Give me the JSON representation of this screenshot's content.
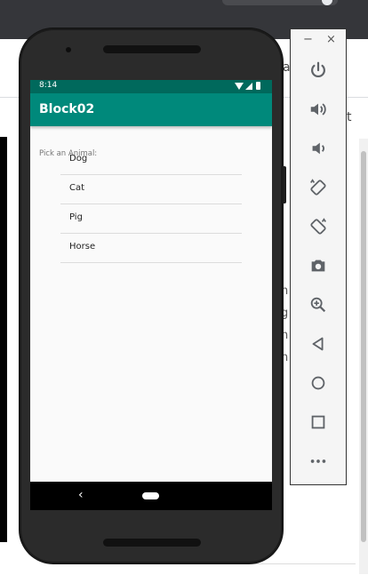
{
  "background": {
    "toolbar_fragment_1": "a",
    "toolbar_fragment_2": "t",
    "side_fragments": [
      "h",
      "g",
      "h",
      "n"
    ]
  },
  "device": {
    "status_bar": {
      "time": "8:14"
    },
    "app_bar": {
      "title": "Block02"
    },
    "content": {
      "pick_label": "Pick an Animal:",
      "animals": [
        "Dog",
        "Cat",
        "Pig",
        "Horse"
      ]
    },
    "nav_bar": {
      "back_glyph": "‹"
    }
  },
  "emulator_toolbar": {
    "minimize_label": "−",
    "close_label": "×",
    "buttons": [
      "power-icon",
      "volume-up-icon",
      "volume-down-icon",
      "rotate-left-icon",
      "rotate-right-icon",
      "camera-icon",
      "zoom-icon",
      "back-icon",
      "home-icon",
      "overview-icon",
      "more-icon"
    ]
  },
  "colors": {
    "status_bar": "#00695c",
    "app_bar": "#00897b",
    "icon": "#5f6368"
  }
}
